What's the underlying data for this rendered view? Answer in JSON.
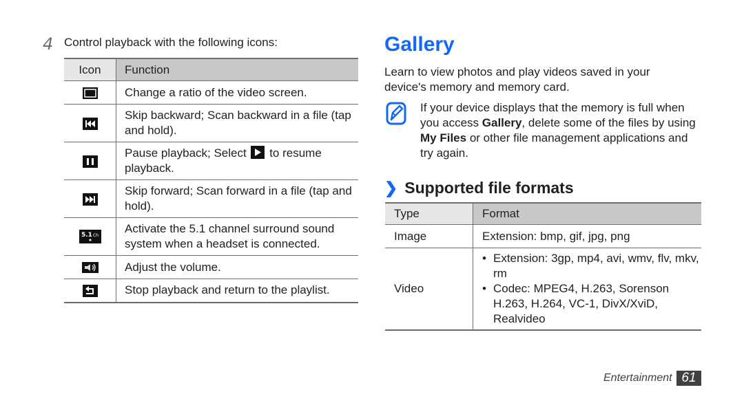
{
  "step": {
    "number": "4",
    "text": "Control playback with the following icons:"
  },
  "icon_table": {
    "headers": [
      "Icon",
      "Function"
    ],
    "rows": [
      {
        "icon": "screen-ratio-icon",
        "text": "Change a ratio of the video screen."
      },
      {
        "icon": "skip-backward-icon",
        "text": "Skip backward; Scan backward in a file (tap and hold)."
      },
      {
        "icon": "pause-icon",
        "text_before": "Pause playback; Select",
        "inline_icon": "play-icon",
        "text_after": "to resume playback."
      },
      {
        "icon": "skip-forward-icon",
        "text": "Skip forward; Scan forward in a file (tap and hold)."
      },
      {
        "icon": "surround-5-1-icon",
        "icon_label": "5.1",
        "icon_sub": "Ch",
        "text": "Activate the 5.1 channel surround sound system when a headset is connected."
      },
      {
        "icon": "volume-icon",
        "text": "Adjust the volume."
      },
      {
        "icon": "back-to-playlist-icon",
        "text": "Stop playback and return to the playlist."
      }
    ]
  },
  "gallery": {
    "title": "Gallery",
    "intro": "Learn to view photos and play videos saved in your device's memory and memory card.",
    "note": {
      "icon": "note-pencil-icon",
      "part1": "If your device displays that the memory is full when you access ",
      "bold1": "Gallery",
      "part2": ", delete some of the files by using ",
      "bold2": "My Files",
      "part3": " or other file management applications and try again."
    }
  },
  "formats": {
    "heading_chevron": "❯",
    "heading": "Supported file formats",
    "headers": [
      "Type",
      "Format"
    ],
    "rows": [
      {
        "type": "Image",
        "formats": [
          "Extension: bmp, gif, jpg, png"
        ]
      },
      {
        "type": "Video",
        "formats": [
          "Extension: 3gp, mp4, avi, wmv, flv, mkv, rm",
          "Codec: MPEG4, H.263, Sorenson H.263, H.264, VC-1, DivX/XviD, Realvideo"
        ]
      }
    ]
  },
  "footer": {
    "section": "Entertainment",
    "page": "61"
  },
  "colors": {
    "accent": "#1469f0",
    "header_light": "#e6e6e6",
    "header_dark": "#c7c8ca",
    "footer_box": "#414042"
  }
}
